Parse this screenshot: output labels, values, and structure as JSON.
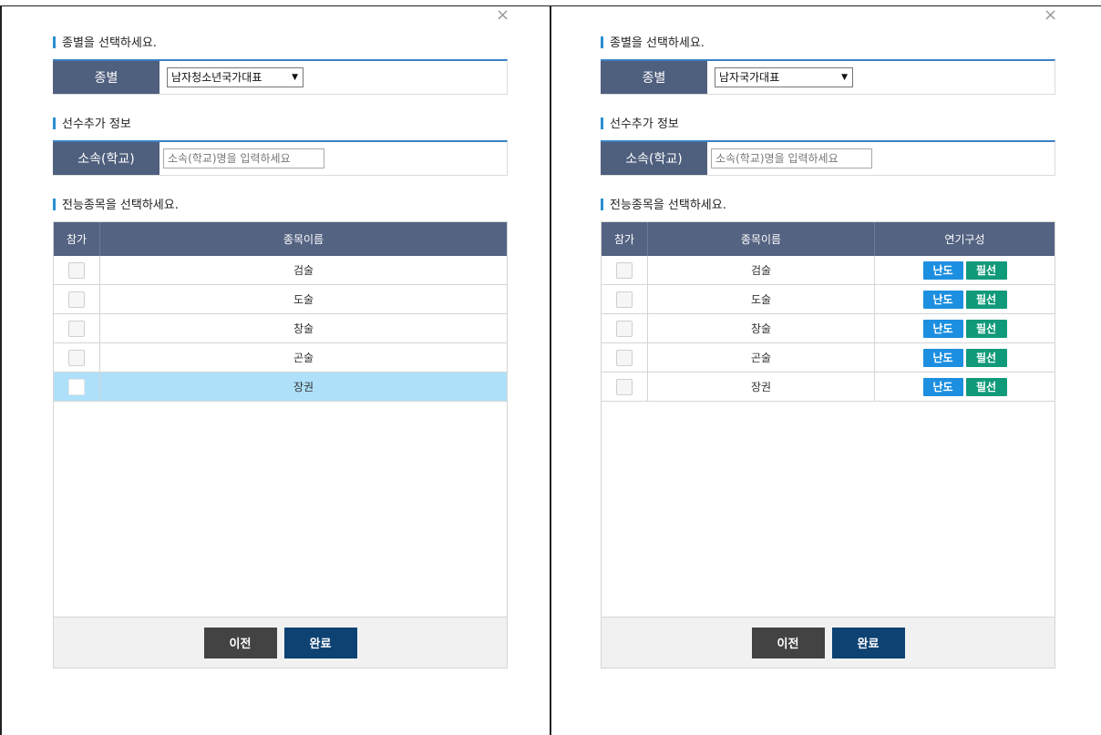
{
  "left_panel": {
    "close_icon": "×",
    "section1_title": "종별을 선택하세요.",
    "category_label": "종별",
    "category_selected": "남자청소년국가대표",
    "category_arrow": "▼",
    "section2_title": "선수추가 정보",
    "affiliation_label": "소속(학교)",
    "affiliation_placeholder": "소속(학교)명을 입력하세요",
    "section3_title": "전능종목을 선택하세요.",
    "col_join": "참가",
    "col_event_name": "종목이름",
    "rows": [
      {
        "name": "검술"
      },
      {
        "name": "도술"
      },
      {
        "name": "창술"
      },
      {
        "name": "곤술"
      },
      {
        "name": "장권"
      }
    ],
    "prev_button": "이전",
    "done_button": "완료"
  },
  "right_panel": {
    "close_icon": "×",
    "section1_title": "종별을 선택하세요.",
    "category_label": "종별",
    "category_selected": "남자국가대표",
    "category_arrow": "▼",
    "section2_title": "선수추가 정보",
    "affiliation_label": "소속(학교)",
    "affiliation_placeholder": "소속(학교)명을 입력하세요",
    "section3_title": "전능종목을 선택하세요.",
    "col_join": "참가",
    "col_event_name": "종목이름",
    "col_composition": "연기구성",
    "rows": [
      {
        "name": "검술",
        "difficulty": "난도",
        "required": "필선"
      },
      {
        "name": "도술",
        "difficulty": "난도",
        "required": "필선"
      },
      {
        "name": "창술",
        "difficulty": "난도",
        "required": "필선"
      },
      {
        "name": "곤술",
        "difficulty": "난도",
        "required": "필선"
      },
      {
        "name": "장권",
        "difficulty": "난도",
        "required": "필선"
      }
    ],
    "prev_button": "이전",
    "done_button": "완료"
  },
  "colors": {
    "header_bg": "#546382",
    "accent_line": "#3a82c4",
    "selected_row": "#aee0fa",
    "difficulty_btn": "#1d8fe0",
    "required_btn": "#119a7a",
    "done_btn": "#0e4273",
    "prev_btn": "#434343"
  }
}
